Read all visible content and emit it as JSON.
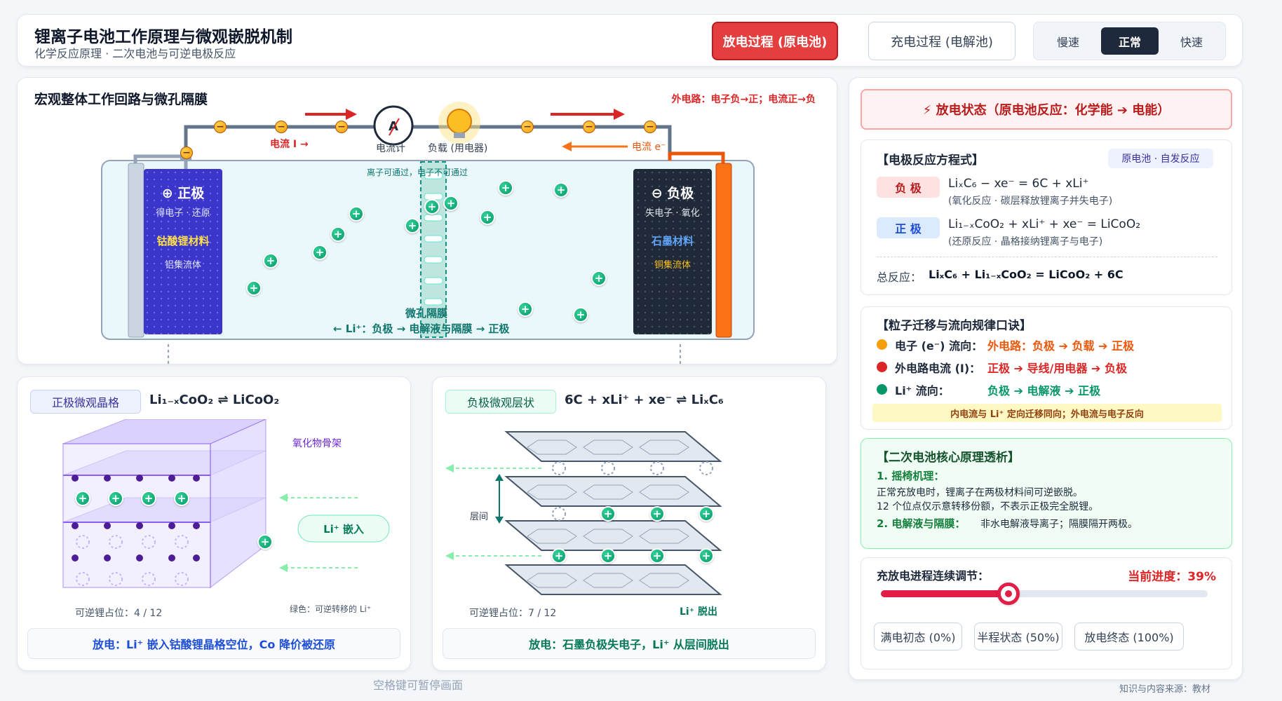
{
  "header": {
    "title": "锂离子电池工作原理与微观嵌脱机制",
    "subtitle": "化学反应原理 · 二次电池与可逆电极反应",
    "mode_discharge": "放电过程 (原电池)",
    "mode_charge": "充电过程 (电解池)",
    "speed_slow": "慢速",
    "speed_normal": "正常",
    "speed_fast": "快速"
  },
  "macro": {
    "title": "宏观整体工作回路与微孔隔膜",
    "circuit_note": "外电路：电子负→正；电流正→负",
    "current_label": "电流 I →",
    "ammeter_label": "电流计",
    "load_label": "负载 (用电器)",
    "electron_label": "电流 e⁻",
    "ion_note": "离子可通过，电子不可通过",
    "separator_label": "微孔隔膜",
    "li_path": "← Li⁺：负极 → 电解液与隔膜 → 正极",
    "pos_title": "⊕ 正极",
    "pos_sub": "得电子 · 还原",
    "pos_material": "钴酸锂材料",
    "pos_collector": "铝集流体",
    "neg_title": "⊖ 负极",
    "neg_sub": "失电子 · 氧化",
    "neg_material": "石墨材料",
    "neg_collector": "铜集流体"
  },
  "cathode_panel": {
    "tag": "正极微观晶格",
    "equation": "Li₁₋ₓCoO₂ ⇌ LiCoO₂",
    "oxide_label": "氧化物骨架",
    "insert_label": "Li⁺ 嵌入",
    "occupancy": "可逆锂占位：4 / 12",
    "legend": "绿色：可逆转移的 Li⁺",
    "footer": "放电：Li⁺ 嵌入钴酸锂晶格空位，Co 降价被还原",
    "occupied": 4,
    "total": 12
  },
  "anode_panel": {
    "tag": "负极微观层状",
    "equation": "6C + xLi⁺ + xe⁻ ⇌ LiₓC₆",
    "layer_label": "层间",
    "occupancy": "可逆锂占位：7 / 12",
    "release_label": "Li⁺ 脱出",
    "footer": "放电：石墨负极失电子，Li⁺ 从层间脱出",
    "occupied": 7,
    "total": 12
  },
  "status": {
    "banner": "⚡ 放电状态（原电池反应：化学能 ➔ 电能）"
  },
  "equations": {
    "title": "【电极反应方程式】",
    "badge": "原电池 · 自发反应",
    "neg_tag": "负 极",
    "neg_eq": "LiₓC₆ − xe⁻ = 6C + xLi⁺",
    "neg_note": "(氧化反应 · 碳层释放锂离子并失电子)",
    "pos_tag": "正 极",
    "pos_eq": "Li₁₋ₓCoO₂ + xLi⁺ + xe⁻ = LiCoO₂",
    "pos_note": "(还原反应 · 晶格接纳锂离子与电子)",
    "total_label": "总反应：",
    "total_eq": "LiₓC₆ + Li₁₋ₓCoO₂ = LiCoO₂ + 6C"
  },
  "migration": {
    "title": "【粒子迁移与流向规律口诀】",
    "rows": [
      {
        "label": "电子 (e⁻) 流向：",
        "value": "外电路：负极 ➔ 负载 ➔ 正极",
        "color": "#f59e0b"
      },
      {
        "label": "外电路电流 (I)：",
        "value": "正极 ➔ 导线/用电器 ➔ 负极",
        "color": "#dc2626"
      },
      {
        "label": "Li⁺ 流向：",
        "value": "负极 ➔ 电解液 ➔ 正极",
        "color": "#059669"
      }
    ],
    "note": "内电流与 Li⁺ 定向迁移同向；外电流与电子反向"
  },
  "principle": {
    "title": "【二次电池核心原理透析】",
    "p1_title": "1. 摇椅机理：",
    "p1_line1": "正常充放电时，锂离子在两极材料间可逆嵌脱。",
    "p1_line2": "12 个位点仅示意转移份额，不表示正极完全脱锂。",
    "p2_title": "2. 电解液与隔膜：",
    "p2_text": "非水电解液导离子；隔膜隔开两极。"
  },
  "progress": {
    "label": "充放电进程连续调节：",
    "current_text": "当前进度：39%",
    "value": 0.39,
    "preset_full": "满电初态 (0%)",
    "preset_half": "半程状态 (50%)",
    "preset_end": "放电终态 (100%)"
  },
  "footer": {
    "hint": "空格键可暂停画面",
    "source": "知识与内容来源：教材"
  },
  "colors": {
    "accent_red": "#dc2626",
    "li_green": "#059669",
    "electron_amber": "#f59e0b",
    "cathode_blue": "#3b35c9",
    "anode_dark": "#1f2937"
  }
}
